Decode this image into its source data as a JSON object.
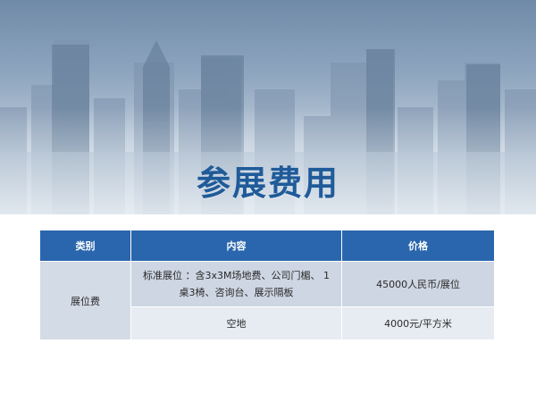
{
  "slide": {
    "title": "参展费用"
  },
  "table": {
    "headers": [
      "类别",
      "内容",
      "价格"
    ],
    "category": "展位费",
    "rows": [
      {
        "content": "标准展位 ：含3x3M场地费、公司门楣、 1桌3椅、咨询台、展示隔板",
        "price": "45000人民币/展位"
      },
      {
        "content": "空地",
        "price": "4000元/平方米"
      }
    ]
  },
  "colors": {
    "title": "#1f5b99",
    "header_bg": "#2a66ad",
    "row_dark": "#cdd6e2",
    "row_light": "#e7ecf2"
  }
}
